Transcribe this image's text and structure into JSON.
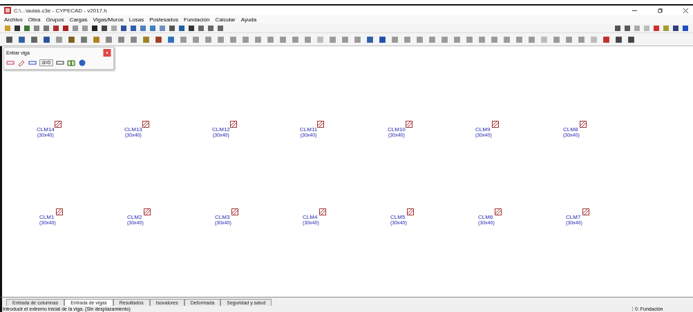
{
  "window": {
    "title": "C:\\...\\aulas.c3e - CYPECAD - v2017.h"
  },
  "menu": [
    "Archivo",
    "Obra",
    "Grupos",
    "Cargas",
    "Vigas/Muros",
    "Losas",
    "Postesados",
    "Fundación",
    "Calcular",
    "Ayuda"
  ],
  "panel": {
    "title": "Entrar viga",
    "offset_button": "d=0"
  },
  "columns_top": [
    {
      "name": "CLM14",
      "size": "(30x40)"
    },
    {
      "name": "CLM13",
      "size": "(30x40)"
    },
    {
      "name": "CLM12",
      "size": "(30x40)"
    },
    {
      "name": "CLM11",
      "size": "(30x40)"
    },
    {
      "name": "CLM10",
      "size": "(30x40)"
    },
    {
      "name": "CLM9",
      "size": "(30x40)"
    },
    {
      "name": "CLM8",
      "size": "(30x40)"
    }
  ],
  "columns_bottom": [
    {
      "name": "CLM1",
      "size": "(30x40)"
    },
    {
      "name": "CLM2",
      "size": "(30x40)"
    },
    {
      "name": "CLM3",
      "size": "(30x40)"
    },
    {
      "name": "CLM4",
      "size": "(30x40)"
    },
    {
      "name": "CLM5",
      "size": "(30x40)"
    },
    {
      "name": "CLM6",
      "size": "(30x40)"
    },
    {
      "name": "CLM7",
      "size": "(30x40)"
    }
  ],
  "tabs": [
    {
      "label": "Entrada de columnas",
      "selected": false
    },
    {
      "label": "Entrada de vigas",
      "selected": true
    },
    {
      "label": "Resultados",
      "selected": false
    },
    {
      "label": "Isovalores",
      "selected": false
    },
    {
      "label": "Deformada",
      "selected": false
    },
    {
      "label": "Seguridad y salud",
      "selected": false
    }
  ],
  "status_bar": {
    "message": "Introducir el extremo inicial de la viga. (Sin desplazamiento)",
    "group": "0: Fundación"
  }
}
